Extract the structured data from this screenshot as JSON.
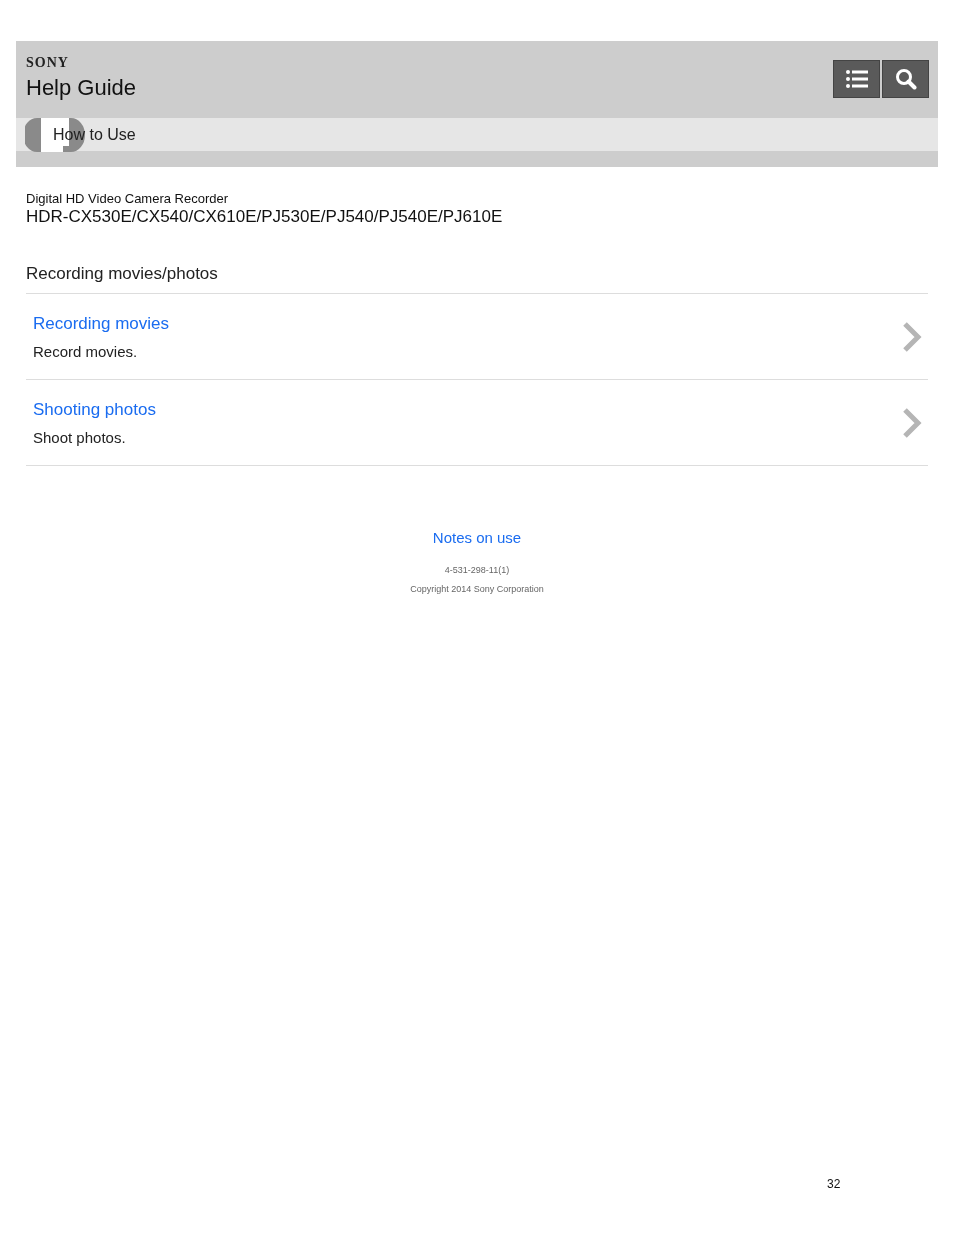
{
  "header": {
    "brand": "SONY",
    "title": "Help Guide",
    "buttons": [
      {
        "kind": "list"
      },
      {
        "kind": "search"
      }
    ]
  },
  "breadcrumb": {
    "label": "How to Use"
  },
  "product": {
    "category": "Digital HD Video Camera Recorder",
    "models": "HDR-CX530E/CX540/CX610E/PJ530E/PJ540/PJ540E/PJ610E"
  },
  "section": {
    "title": "Recording movies/photos"
  },
  "items": [
    {
      "title": "Recording movies",
      "description": "Record movies."
    },
    {
      "title": "Shooting photos",
      "description": "Shoot photos."
    }
  ],
  "footer": {
    "link": "Notes on use",
    "code": "4-531-298-11(1)",
    "copyright": "Copyright 2014 Sony Corporation"
  },
  "page_number": "32"
}
